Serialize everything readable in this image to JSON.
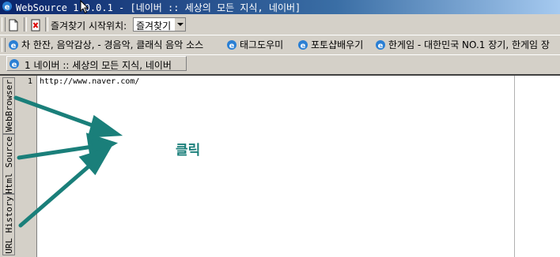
{
  "window": {
    "title": "WebSource 1.0.0.1 - [네이버 :: 세상의 모든 지식, 네이버]"
  },
  "toolbar": {
    "favorites_label": "즐겨찾기 시작위치:",
    "favorites_value": "즐겨찾기"
  },
  "links": [
    {
      "label": "차 한잔, 음악감상, - 경음악, 클래식 음악 소스"
    },
    {
      "label": "태그도우미"
    },
    {
      "label": "포토샵배우기"
    },
    {
      "label": "한게임 - 대한민국 NO.1 장기, 한게임 장"
    }
  ],
  "tab": {
    "label": "1 네이버 :: 세상의 모든 지식, 네이버"
  },
  "side_tabs": [
    {
      "label": "WebBrowser"
    },
    {
      "label": "Html Source"
    },
    {
      "label": "URL History"
    }
  ],
  "editor": {
    "line_number": "1",
    "line_text": "http://www.naver.com/"
  },
  "annotation": {
    "text": "클릭",
    "color": "#1a7f7a"
  },
  "icons": [
    "ie-icon",
    "new-document-icon",
    "close-icon",
    "cursor-icon"
  ]
}
